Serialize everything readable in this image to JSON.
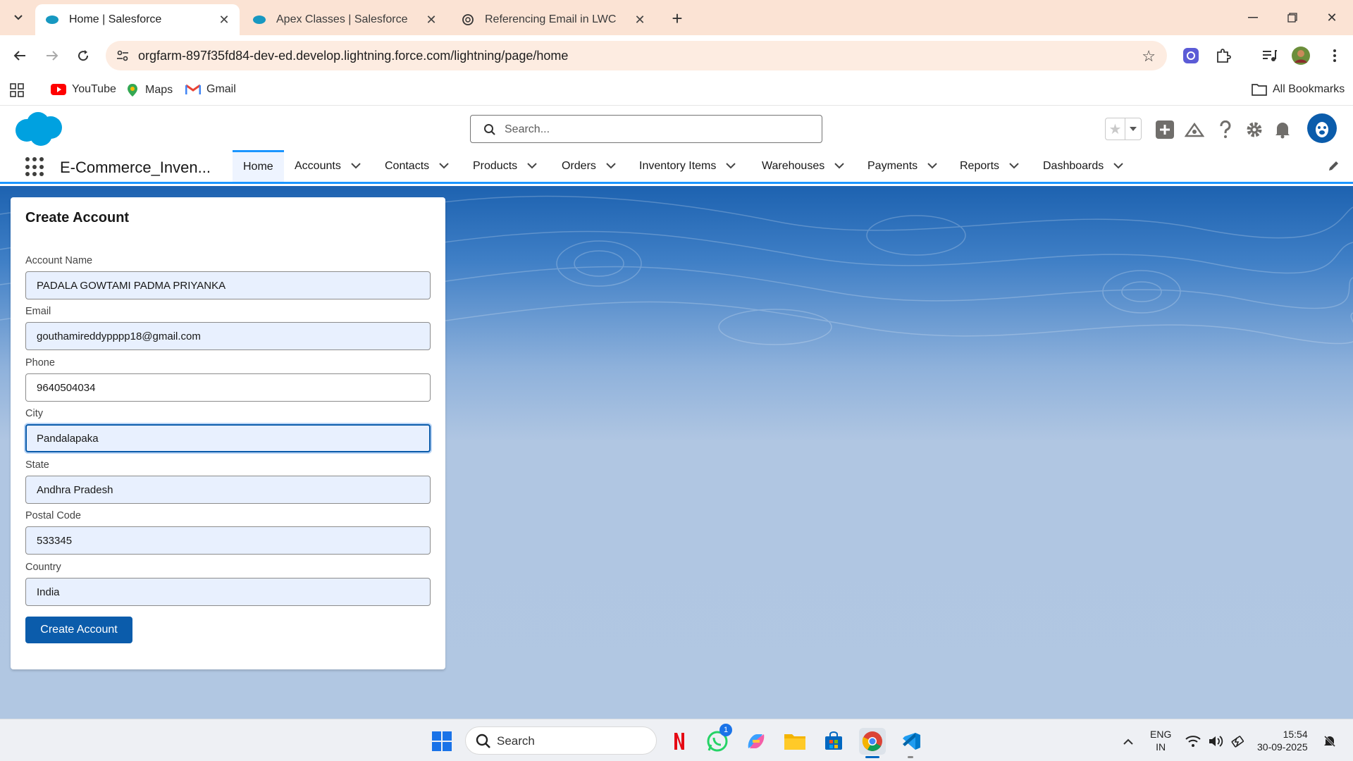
{
  "browser": {
    "tabs": [
      {
        "title": "Home | Salesforce",
        "active": true
      },
      {
        "title": "Apex Classes | Salesforce",
        "active": false
      },
      {
        "title": "Referencing Email in LWC",
        "active": false
      }
    ],
    "url": "orgfarm-897f35fd84-dev-ed.develop.lightning.force.com/lightning/page/home",
    "bookmarks": [
      "YouTube",
      "Maps",
      "Gmail"
    ],
    "all_bookmarks": "All Bookmarks"
  },
  "sf": {
    "search_placeholder": "Search...",
    "app_name": "E-Commerce_Inven...",
    "nav": [
      "Home",
      "Accounts",
      "Contacts",
      "Products",
      "Orders",
      "Inventory Items",
      "Warehouses",
      "Payments",
      "Reports",
      "Dashboards"
    ]
  },
  "form": {
    "title": "Create Account",
    "fields": [
      {
        "label": "Account Name",
        "value": "PADALA GOWTAMI PADMA PRIYANKA"
      },
      {
        "label": "Email",
        "value": "gouthamireddypppp18@gmail.com"
      },
      {
        "label": "Phone",
        "value": "9640504034"
      },
      {
        "label": "City",
        "value": "Pandalapaka"
      },
      {
        "label": "State",
        "value": "Andhra Pradesh"
      },
      {
        "label": "Postal Code",
        "value": "533345"
      },
      {
        "label": "Country",
        "value": "India"
      }
    ],
    "submit_label": "Create Account"
  },
  "taskbar": {
    "search_label": "Search",
    "whatsapp_badge": "1",
    "lang_top": "ENG",
    "lang_bottom": "IN",
    "time": "15:54",
    "date": "30-09-2025"
  },
  "colors": {
    "brand": "#0b5cab",
    "accent": "#1b96ff",
    "tab_strip": "#fbe3d4"
  }
}
